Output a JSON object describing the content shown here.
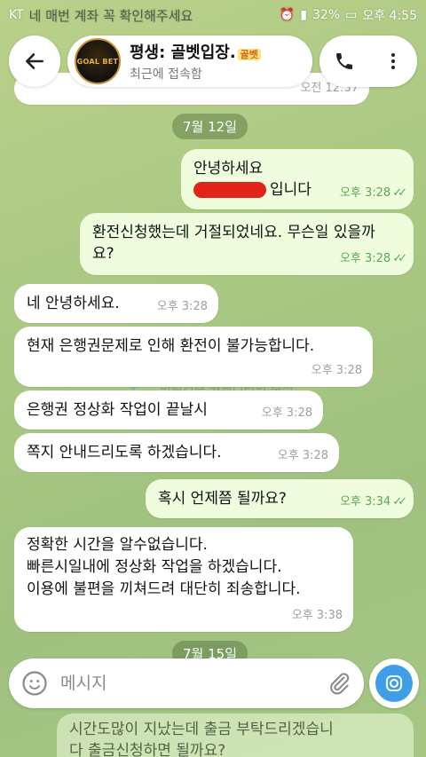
{
  "status_bar": {
    "carrier": "KT",
    "notification_text": "네 매번 계좌 꼭 확인해주세요",
    "battery": "32%",
    "clock": "오후 4:55"
  },
  "header": {
    "avatar_label": "GOAL BET",
    "title": "평생: 골벳입장.",
    "title_tag": "골벳",
    "subtitle": "최근에 접속함"
  },
  "messages": {
    "m0_time": "오전 12:37",
    "date_1": "7월 12일",
    "m1_line1": "안녕하세요",
    "m1_line2": "입니다",
    "m1_time": "오후 3:28",
    "m2_text": "환전신청했는데 거절되었네요. 무슨일 있을까요?",
    "m2_time": "오후 3:28",
    "m3_text": "네 안녕하세요.",
    "m3_time": "오후 3:28",
    "m4_text": "현재 은행권문제로 인해 환전이 불가능합니다.",
    "m4_time": "오후 3:28",
    "m5_text": "은행권 정상화 작업이 끝날시",
    "m5_time": "오후 3:28",
    "m6_text": "쪽지 안내드리도록 하겠습니다.",
    "m6_time": "오후 3:28",
    "m7_text": "혹시 언제쯤 될까요?",
    "m7_time": "오후 3:34",
    "m8_line1": "정확한 시간을 알수없습니다.",
    "m8_line2": "빠른시일내에 정상화 작업을 하겠습니다.",
    "m8_line3": "이용에 불편을 끼쳐드려 대단히 죄송합니다.",
    "m8_time": "오후 3:38",
    "date_2": "7월 15일",
    "m9_line1": "시간도많이 지났는데 출금 부탁드리겠습니",
    "m9_line2": "다 출금신청하면 될까요?"
  },
  "watermark": {
    "brand": "챌",
    "subtitle": "먹튀검증 커뮤니티의 중심"
  },
  "input": {
    "placeholder": "메시지"
  },
  "colors": {
    "outgoing_bubble": "#effdde",
    "incoming_bubble": "#ffffff",
    "accent": "#3e9ee7",
    "check_green": "#5aa755"
  }
}
